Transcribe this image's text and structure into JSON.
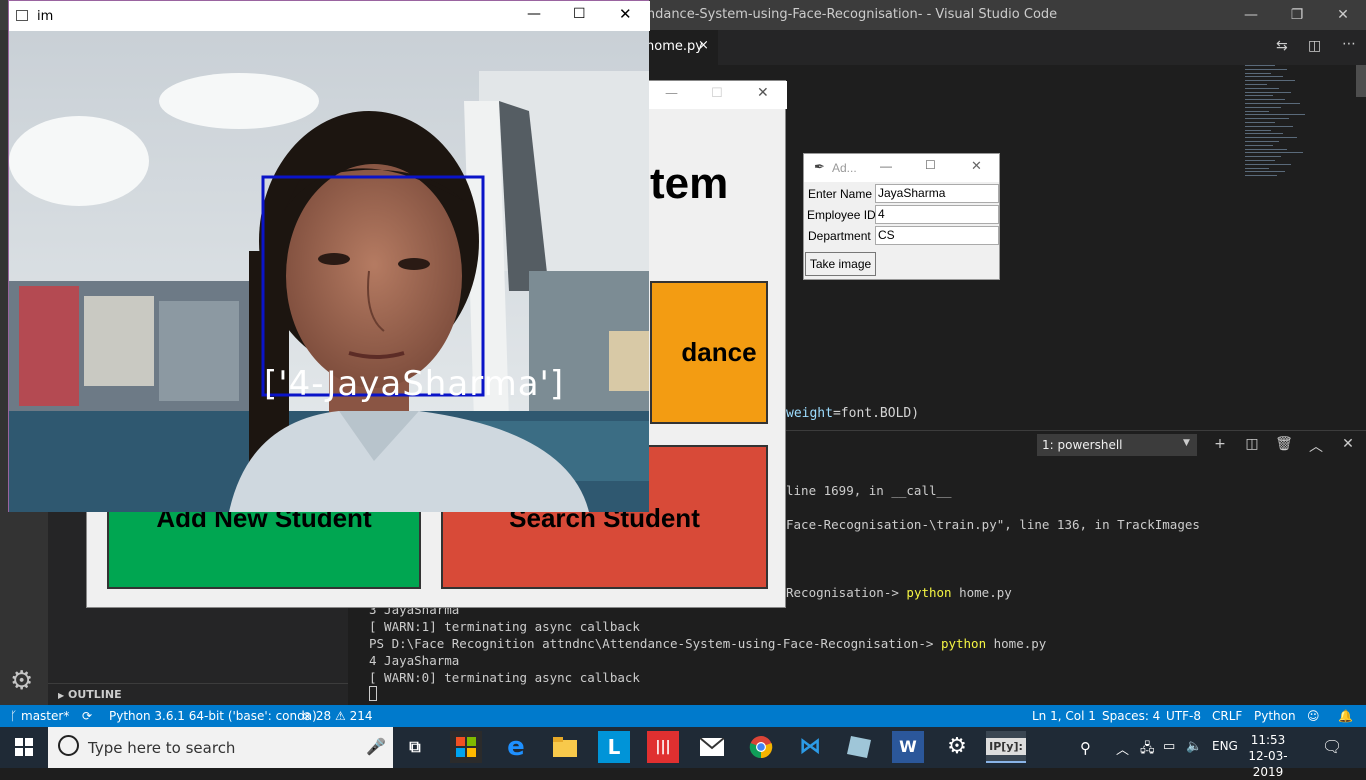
{
  "vscode": {
    "window_title": "Attendance-System-using-Face-Recognisation- - Visual Studio Code",
    "tab_label": "home.py",
    "tab_close": "×",
    "code_fragment_kw": "weight",
    "code_fragment_rest": "=font.BOLD)",
    "outline_label": "OUTLINE",
    "terminal_select": "1: powershell",
    "terminal_lines": [
      {
        "text": "line 1699, in __call__",
        "indent": true
      },
      {
        "text": "Face-Recognisation-\\train.py\", line 136, in TrackImages",
        "indent": true
      },
      {
        "text": "Recognisation-> ",
        "py": "python",
        "rest": " home.py",
        "indent": true
      },
      {
        "text": "3 JayaSharma"
      },
      {
        "text": "[ WARN:1] terminating async callback"
      },
      {
        "text": "PS D:\\Face Recognition attndnc\\Attendance-System-using-Face-Recognisation-> ",
        "py": "python",
        "rest": " home.py"
      },
      {
        "text": "4 JayaSharma"
      },
      {
        "text": "[ WARN:0] terminating async callback"
      }
    ]
  },
  "statusbar": {
    "branch": "master*",
    "python": "Python 3.6.1 64-bit ('base': conda)",
    "errors": "28",
    "warnings": "214",
    "position": "Ln 1, Col 1",
    "spaces": "Spaces: 4",
    "encoding": "UTF-8",
    "eol": "CRLF",
    "language": "Python"
  },
  "tk_main": {
    "heading_fragment": "tem",
    "btn_attendance_fragment": "dance",
    "btn_add": "Add New Student",
    "btn_search": "Search Student"
  },
  "cv_window": {
    "title": "im",
    "face_label": "['4-JayaSharma']",
    "colors": {
      "box": "#0a14c8",
      "label": "#ffffff"
    }
  },
  "dialog": {
    "title": "Ad...",
    "fields": [
      {
        "label": "Enter Name",
        "value": "JayaSharma"
      },
      {
        "label": "Employee ID",
        "value": "4"
      },
      {
        "label": "Department",
        "value": "CS"
      }
    ],
    "button": "Take image"
  },
  "taskbar": {
    "search_placeholder": "Type here to search",
    "language": "ENG",
    "time": "11:53",
    "date": "12-03-2019"
  },
  "icons": [
    "windows-start-icon",
    "search-icon",
    "mic-icon",
    "task-view-icon",
    "store-icon",
    "edge-icon",
    "file-explorer-icon",
    "l-app-icon",
    "stacks-app-icon",
    "mail-icon",
    "chrome-icon",
    "vscode-icon",
    "notes-icon",
    "word-icon",
    "settings-icon",
    "ipython-icon",
    "people-icon",
    "chevron-up-icon",
    "network-icon",
    "volume-icon",
    "notification-icon",
    "gear-icon",
    "branch-icon",
    "sync-icon",
    "error-icon",
    "warning-icon",
    "feedback-icon",
    "bell-icon"
  ]
}
